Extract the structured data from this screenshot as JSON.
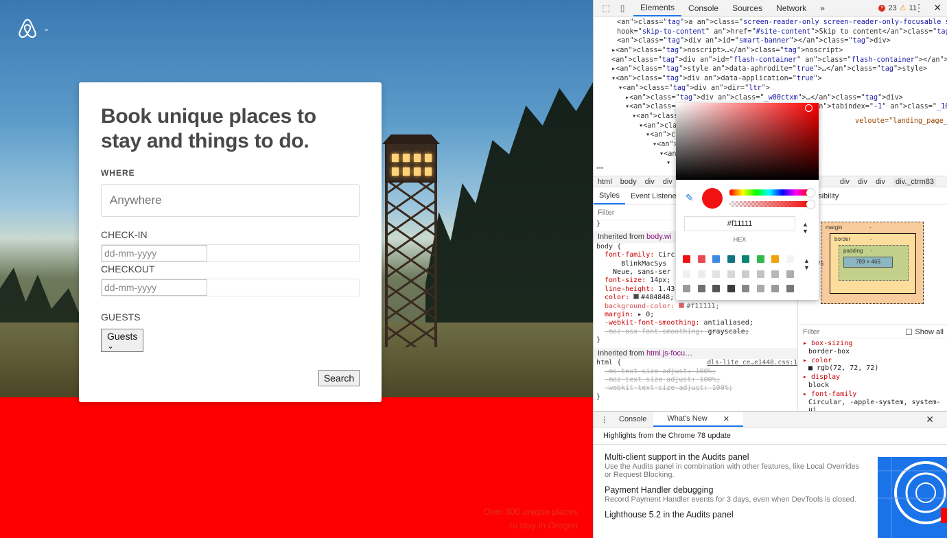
{
  "landing": {
    "headline": "Book unique places to stay and things to do.",
    "where_label": "WHERE",
    "where_placeholder": "Anywhere",
    "checkin_label": "CHECK-IN",
    "checkin_placeholder": "dd-mm-yyyy",
    "checkout_label": "CHECKOUT",
    "checkout_placeholder": "dd-mm-yyyy",
    "guests_label": "GUESTS",
    "guests_button": "Guests",
    "search_button": "Search",
    "promo_line1": "Over 300 unique places",
    "promo_line2": "to stay in Oregon",
    "logo_icon": "airbnb-logo-icon",
    "band_color": "#ff0000"
  },
  "devtools": {
    "tabs": [
      "Elements",
      "Console",
      "Sources",
      "Network"
    ],
    "more_tabs": "»",
    "error_count": "23",
    "warning_count": "11",
    "dom_lines": [
      {
        "indent": 0,
        "html": "<a class=\"screen-reader-only screen-reader-only-focusable skip-to-content\" data-"
      },
      {
        "indent": 0,
        "html": "hook=\"skip-to-content\" href=\"#site-content\">Skip to content</a>"
      },
      {
        "indent": 0,
        "html": "<div id=\"smart-banner\"></div>"
      },
      {
        "indent": 0,
        "html": "▸<noscript>…</noscript>"
      },
      {
        "indent": 0,
        "html": "<div id=\"flash-container\" class=\"flash-container\"></div>"
      },
      {
        "indent": 0,
        "html": "▸<style data-aphrodite=\"true\">…</style>"
      },
      {
        "indent": 0,
        "html": "▾<div data-application=\"true\">"
      },
      {
        "indent": 1,
        "html": "▾<div dir=\"ltr\">"
      },
      {
        "indent": 2,
        "html": "▸<div class=\"_w00ctxm\">…</div>"
      },
      {
        "indent": 2,
        "html": "▾<main id=\"site-content\" tabindex=\"-1\" class=\"_16grqhk\">"
      },
      {
        "indent": 3,
        "html": "▾<section>"
      },
      {
        "indent": 4,
        "html": "▾<div cl"
      },
      {
        "indent": 5,
        "html": "▾<div c"
      },
      {
        "indent": 6,
        "html": "▾<div"
      },
      {
        "indent": 7,
        "html": "▾<d"
      },
      {
        "indent": 8,
        "html": "▾"
      }
    ],
    "dom_fragment_right": "veloute=\"landing_page_header\">",
    "breadcrumbs": [
      "html",
      "body",
      "div",
      "div",
      "div",
      "div",
      "div",
      "div",
      "div._ctrm83"
    ],
    "subtabs": [
      "Styles",
      "Event Listene",
      "ccessibility"
    ],
    "styles_filter": "Filter",
    "inherited_body_label": "Inherited from",
    "inherited_body_link": "body.wi",
    "inherited_html_label": "Inherited from",
    "inherited_html_link": "html.js-focu…",
    "css_source": "dls-lite_ce…e1448.css:1",
    "body_rules": [
      {
        "prop": "font-family",
        "val": "Circ",
        "struck": false
      },
      {
        "prop": "",
        "val": "    BlinkMacSys",
        "struck": false
      },
      {
        "prop": "",
        "val": "  Neue, sans-ser",
        "struck": false
      },
      {
        "prop": "font-size",
        "val": "14px;",
        "struck": false
      },
      {
        "prop": "line-height",
        "val": "1.43",
        "struck": false
      },
      {
        "prop": "color",
        "val": "#484848;",
        "struck": false
      },
      {
        "prop": "background-color",
        "val": "#f11111;",
        "struck": false
      },
      {
        "prop": "margin",
        "val": "▸ 0;",
        "struck": false
      },
      {
        "prop": "-webkit-font-smoothing",
        "val": "antialiased;",
        "struck": false
      },
      {
        "prop": "-moz-osx-font-smoothing",
        "val": "grayscale;",
        "struck": true
      }
    ],
    "html_rules": [
      {
        "prop": "-ms-text-size-adjust",
        "val": "100%;"
      },
      {
        "prop": "-moz-text-size-adjust",
        "val": "100%;"
      },
      {
        "prop": "-webkit-text-size-adjust",
        "val": "100%;"
      }
    ],
    "box_model": {
      "margin_label": "margin",
      "border_label": "border",
      "padding_label": "padding",
      "dash": "-",
      "left_value": "76",
      "content": "789 × 466"
    },
    "computed_filter": "Filter",
    "show_all": "Show all",
    "computed": [
      {
        "prop": "box-sizing",
        "val": "border-box"
      },
      {
        "prop": "color",
        "val": "rgb(72, 72, 72)"
      },
      {
        "prop": "display",
        "val": "block"
      },
      {
        "prop": "font-family",
        "val": "Circular, -apple-system, system-ui"
      }
    ],
    "drawer_tabs": [
      "Console",
      "What's New"
    ],
    "highlights": "Highlights from the Chrome 78 update",
    "news": [
      {
        "title": "Multi-client support in the Audits panel",
        "desc": "Use the Audits panel in combination with other features, like Local Overrides or Request Blocking."
      },
      {
        "title": "Payment Handler debugging",
        "desc": "Record Payment Handler events for 3 days, even when DevTools is closed."
      },
      {
        "title": "Lighthouse 5.2 in the Audits panel",
        "desc": ""
      }
    ]
  },
  "color_picker": {
    "hex_value": "#f11111",
    "format_label": "HEX",
    "current_color": "#f11111",
    "palette": [
      "#f11111",
      "#e84855",
      "#3f88e5",
      "#127480",
      "#0a8574",
      "#33b84c",
      "#f0a20c",
      "#f3f3f3",
      "#f0f0f0",
      "#ececec",
      "#e3e3e3",
      "#d8d8d8",
      "#cccccc",
      "#c2c2c2",
      "#b8b8b8",
      "#adadad",
      "#9a9a9a",
      "#6f6f6f",
      "#555555",
      "#3c3c3c",
      "#888888",
      "#aaaaaa",
      "#999999",
      "#777777"
    ]
  }
}
